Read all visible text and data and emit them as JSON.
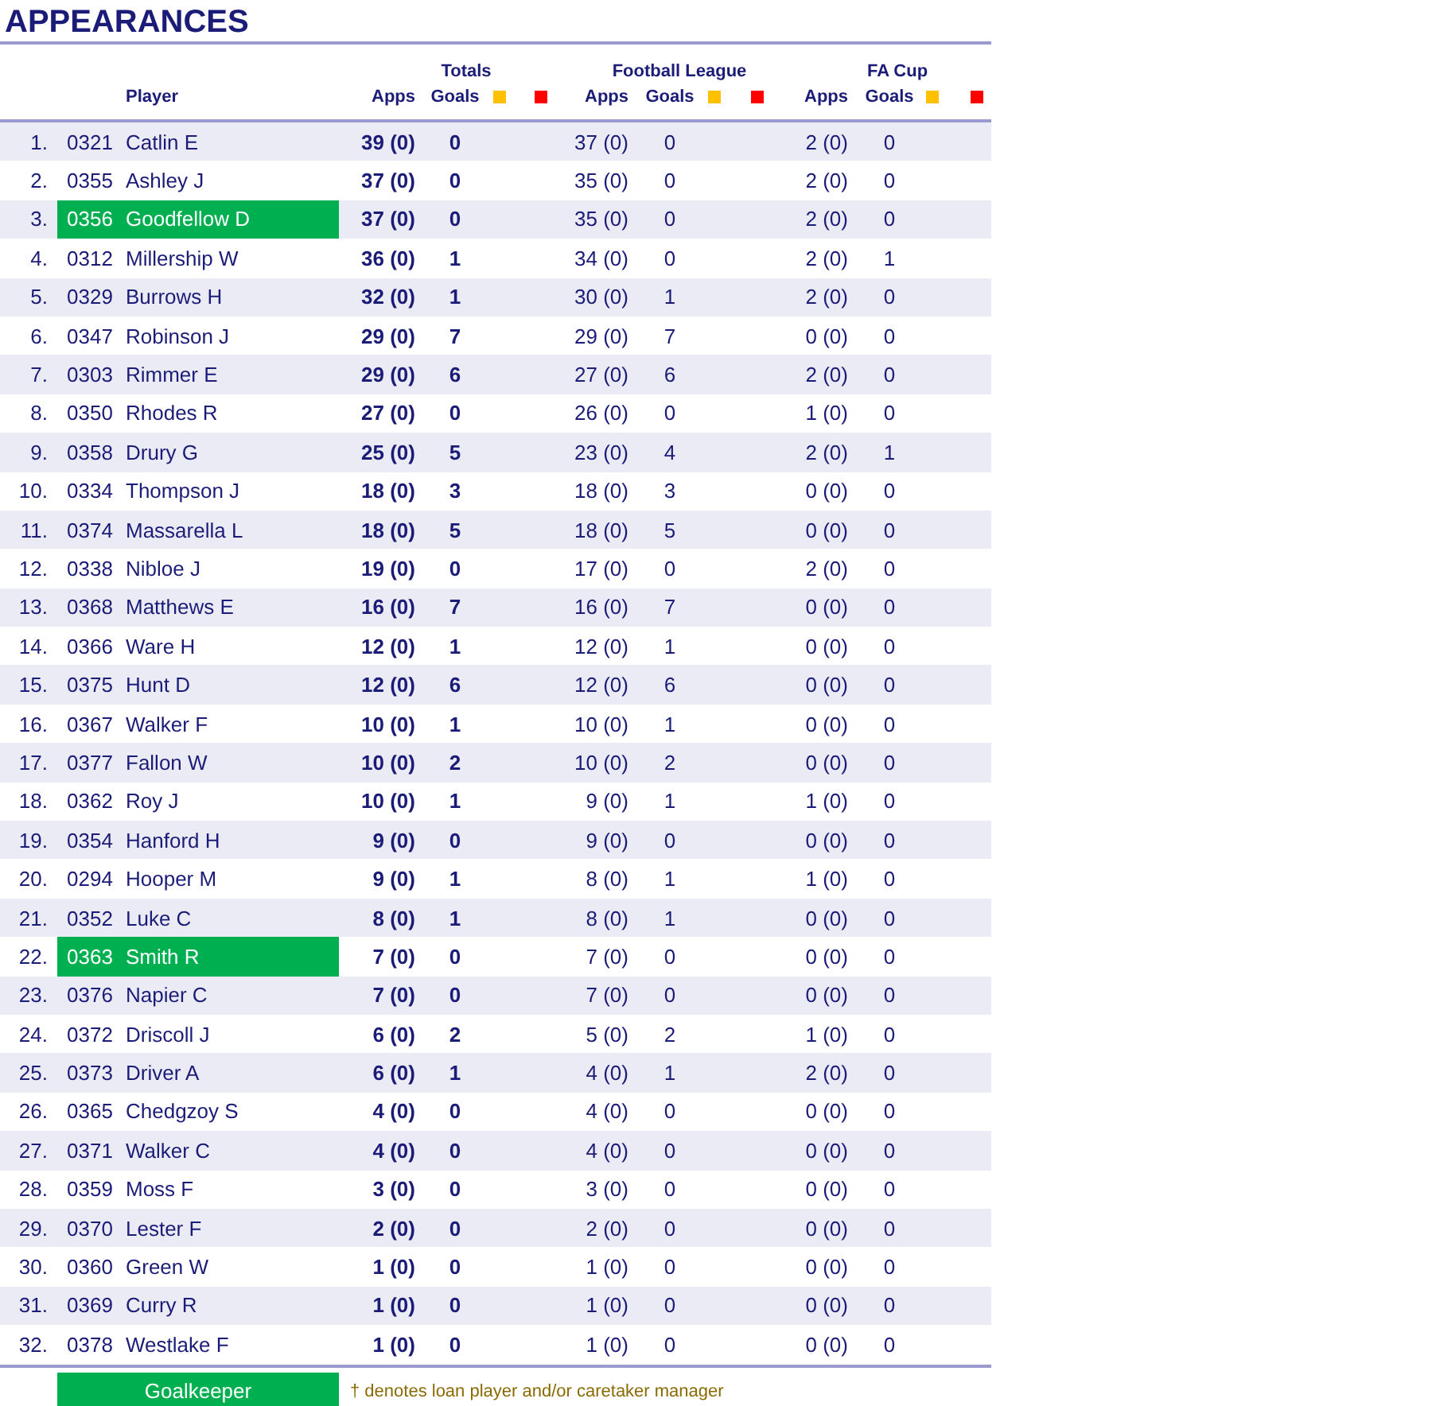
{
  "title": "APPEARANCES",
  "header": {
    "player": "Player",
    "groups": [
      {
        "title": "Totals",
        "apps": "Apps",
        "goals": "Goals",
        "cards": [
          {
            "kind": "yellow"
          },
          {
            "kind": "red"
          }
        ]
      },
      {
        "title": "Football League",
        "apps": "Apps",
        "goals": "Goals",
        "cards": [
          {
            "kind": "yellow"
          },
          {
            "kind": "red"
          }
        ]
      },
      {
        "title": "FA Cup",
        "apps": "Apps",
        "goals": "Goals",
        "cards": [
          {
            "kind": "yellow"
          },
          {
            "kind": "red"
          }
        ]
      }
    ]
  },
  "rows": [
    {
      "no": "1.",
      "code": "0321",
      "name": "Catlin E",
      "goalkeeper": false,
      "apps": [
        "39 (0)",
        "37 (0)",
        "2 (0)"
      ],
      "goals": [
        "0",
        "0",
        "0"
      ]
    },
    {
      "no": "2.",
      "code": "0355",
      "name": "Ashley J",
      "goalkeeper": false,
      "apps": [
        "37 (0)",
        "35 (0)",
        "2 (0)"
      ],
      "goals": [
        "0",
        "0",
        "0"
      ]
    },
    {
      "no": "3.",
      "code": "0356",
      "name": "Goodfellow D",
      "goalkeeper": true,
      "apps": [
        "37 (0)",
        "35 (0)",
        "2 (0)"
      ],
      "goals": [
        "0",
        "0",
        "0"
      ]
    },
    {
      "no": "4.",
      "code": "0312",
      "name": "Millership W",
      "goalkeeper": false,
      "apps": [
        "36 (0)",
        "34 (0)",
        "2 (0)"
      ],
      "goals": [
        "1",
        "0",
        "1"
      ]
    },
    {
      "no": "5.",
      "code": "0329",
      "name": "Burrows H",
      "goalkeeper": false,
      "apps": [
        "32 (0)",
        "30 (0)",
        "2 (0)"
      ],
      "goals": [
        "1",
        "1",
        "0"
      ]
    },
    {
      "no": "6.",
      "code": "0347",
      "name": "Robinson J",
      "goalkeeper": false,
      "apps": [
        "29 (0)",
        "29 (0)",
        "0 (0)"
      ],
      "goals": [
        "7",
        "7",
        "0"
      ]
    },
    {
      "no": "7.",
      "code": "0303",
      "name": "Rimmer E",
      "goalkeeper": false,
      "apps": [
        "29 (0)",
        "27 (0)",
        "2 (0)"
      ],
      "goals": [
        "6",
        "6",
        "0"
      ]
    },
    {
      "no": "8.",
      "code": "0350",
      "name": "Rhodes R",
      "goalkeeper": false,
      "apps": [
        "27 (0)",
        "26 (0)",
        "1 (0)"
      ],
      "goals": [
        "0",
        "0",
        "0"
      ]
    },
    {
      "no": "9.",
      "code": "0358",
      "name": "Drury G",
      "goalkeeper": false,
      "apps": [
        "25 (0)",
        "23 (0)",
        "2 (0)"
      ],
      "goals": [
        "5",
        "4",
        "1"
      ]
    },
    {
      "no": "10.",
      "code": "0334",
      "name": "Thompson J",
      "goalkeeper": false,
      "apps": [
        "18 (0)",
        "18 (0)",
        "0 (0)"
      ],
      "goals": [
        "3",
        "3",
        "0"
      ]
    },
    {
      "no": "11.",
      "code": "0374",
      "name": "Massarella L",
      "goalkeeper": false,
      "apps": [
        "18 (0)",
        "18 (0)",
        "0 (0)"
      ],
      "goals": [
        "5",
        "5",
        "0"
      ]
    },
    {
      "no": "12.",
      "code": "0338",
      "name": "Nibloe J",
      "goalkeeper": false,
      "apps": [
        "19 (0)",
        "17 (0)",
        "2 (0)"
      ],
      "goals": [
        "0",
        "0",
        "0"
      ]
    },
    {
      "no": "13.",
      "code": "0368",
      "name": "Matthews E",
      "goalkeeper": false,
      "apps": [
        "16 (0)",
        "16 (0)",
        "0 (0)"
      ],
      "goals": [
        "7",
        "7",
        "0"
      ]
    },
    {
      "no": "14.",
      "code": "0366",
      "name": "Ware H",
      "goalkeeper": false,
      "apps": [
        "12 (0)",
        "12 (0)",
        "0 (0)"
      ],
      "goals": [
        "1",
        "1",
        "0"
      ]
    },
    {
      "no": "15.",
      "code": "0375",
      "name": "Hunt D",
      "goalkeeper": false,
      "apps": [
        "12 (0)",
        "12 (0)",
        "0 (0)"
      ],
      "goals": [
        "6",
        "6",
        "0"
      ]
    },
    {
      "no": "16.",
      "code": "0367",
      "name": "Walker F",
      "goalkeeper": false,
      "apps": [
        "10 (0)",
        "10 (0)",
        "0 (0)"
      ],
      "goals": [
        "1",
        "1",
        "0"
      ]
    },
    {
      "no": "17.",
      "code": "0377",
      "name": "Fallon W",
      "goalkeeper": false,
      "apps": [
        "10 (0)",
        "10 (0)",
        "0 (0)"
      ],
      "goals": [
        "2",
        "2",
        "0"
      ]
    },
    {
      "no": "18.",
      "code": "0362",
      "name": "Roy J",
      "goalkeeper": false,
      "apps": [
        "10 (0)",
        "9 (0)",
        "1 (0)"
      ],
      "goals": [
        "1",
        "1",
        "0"
      ]
    },
    {
      "no": "19.",
      "code": "0354",
      "name": "Hanford H",
      "goalkeeper": false,
      "apps": [
        "9 (0)",
        "9 (0)",
        "0 (0)"
      ],
      "goals": [
        "0",
        "0",
        "0"
      ]
    },
    {
      "no": "20.",
      "code": "0294",
      "name": "Hooper M",
      "goalkeeper": false,
      "apps": [
        "9 (0)",
        "8 (0)",
        "1 (0)"
      ],
      "goals": [
        "1",
        "1",
        "0"
      ]
    },
    {
      "no": "21.",
      "code": "0352",
      "name": "Luke C",
      "goalkeeper": false,
      "apps": [
        "8 (0)",
        "8 (0)",
        "0 (0)"
      ],
      "goals": [
        "1",
        "1",
        "0"
      ]
    },
    {
      "no": "22.",
      "code": "0363",
      "name": "Smith R",
      "goalkeeper": true,
      "apps": [
        "7 (0)",
        "7 (0)",
        "0 (0)"
      ],
      "goals": [
        "0",
        "0",
        "0"
      ]
    },
    {
      "no": "23.",
      "code": "0376",
      "name": "Napier C",
      "goalkeeper": false,
      "apps": [
        "7 (0)",
        "7 (0)",
        "0 (0)"
      ],
      "goals": [
        "0",
        "0",
        "0"
      ]
    },
    {
      "no": "24.",
      "code": "0372",
      "name": "Driscoll J",
      "goalkeeper": false,
      "apps": [
        "6 (0)",
        "5 (0)",
        "1 (0)"
      ],
      "goals": [
        "2",
        "2",
        "0"
      ]
    },
    {
      "no": "25.",
      "code": "0373",
      "name": "Driver A",
      "goalkeeper": false,
      "apps": [
        "6 (0)",
        "4 (0)",
        "2 (0)"
      ],
      "goals": [
        "1",
        "1",
        "0"
      ]
    },
    {
      "no": "26.",
      "code": "0365",
      "name": "Chedgzoy S",
      "goalkeeper": false,
      "apps": [
        "4 (0)",
        "4 (0)",
        "0 (0)"
      ],
      "goals": [
        "0",
        "0",
        "0"
      ]
    },
    {
      "no": "27.",
      "code": "0371",
      "name": "Walker C",
      "goalkeeper": false,
      "apps": [
        "4 (0)",
        "4 (0)",
        "0 (0)"
      ],
      "goals": [
        "0",
        "0",
        "0"
      ]
    },
    {
      "no": "28.",
      "code": "0359",
      "name": "Moss F",
      "goalkeeper": false,
      "apps": [
        "3 (0)",
        "3 (0)",
        "0 (0)"
      ],
      "goals": [
        "0",
        "0",
        "0"
      ]
    },
    {
      "no": "29.",
      "code": "0370",
      "name": "Lester F",
      "goalkeeper": false,
      "apps": [
        "2 (0)",
        "2 (0)",
        "0 (0)"
      ],
      "goals": [
        "0",
        "0",
        "0"
      ]
    },
    {
      "no": "30.",
      "code": "0360",
      "name": "Green W",
      "goalkeeper": false,
      "apps": [
        "1 (0)",
        "1 (0)",
        "0 (0)"
      ],
      "goals": [
        "0",
        "0",
        "0"
      ]
    },
    {
      "no": "31.",
      "code": "0369",
      "name": "Curry R",
      "goalkeeper": false,
      "apps": [
        "1 (0)",
        "1 (0)",
        "0 (0)"
      ],
      "goals": [
        "0",
        "0",
        "0"
      ]
    },
    {
      "no": "32.",
      "code": "0378",
      "name": "Westlake F",
      "goalkeeper": false,
      "apps": [
        "1 (0)",
        "1 (0)",
        "0 (0)"
      ],
      "goals": [
        "0",
        "0",
        "0"
      ]
    }
  ],
  "legend": {
    "goalkeeper": "Goalkeeper",
    "note": "† denotes loan player and/or caretaker manager"
  }
}
